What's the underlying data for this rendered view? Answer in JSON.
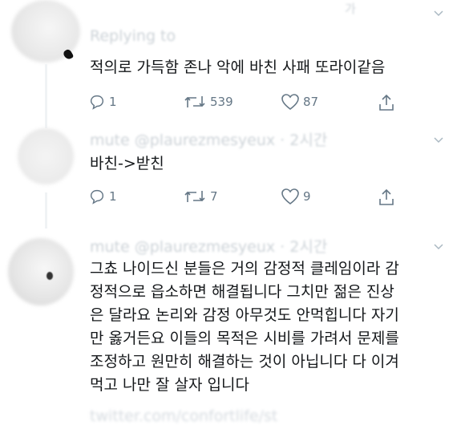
{
  "tweets": [
    {
      "header": "Replying to",
      "header_top_right": "가",
      "text": "적의로 가득함 존나 악에 바친 사패 또라이같음",
      "replies": "1",
      "retweets": "539",
      "likes": "87"
    },
    {
      "header": "mute @plaurezmesyeux · 2시간",
      "text": "바친->받친",
      "replies": "1",
      "retweets": "7",
      "likes": "9"
    },
    {
      "header": "mute @plaurezmesyeux · 2시간",
      "text_lines": [
        "그쵸 나이드신 분들은 거의 감정적 클레임이라 감",
        "정적으로 읍소하면 해결됩니다 그치만 젊은 진상",
        "은 달라요 논리와 감정 아무것도 안먹힙니다 자기",
        "만 옳거든요 이들의 목적은 시비를 가려서 문제를",
        "조정하고 원만히 해결하는 것이 아닙니다 다 이겨",
        "먹고 나만 잘 살자 입니다"
      ],
      "footer": "twitter.com/confortlife/st"
    }
  ],
  "icons": {
    "reply": "reply-icon",
    "retweet": "retweet-icon",
    "like": "like-icon",
    "share": "share-icon",
    "menu": "chevron-down-icon"
  },
  "colors": {
    "text": "#14171a",
    "muted": "#657786",
    "line": "#e1e8ed"
  }
}
